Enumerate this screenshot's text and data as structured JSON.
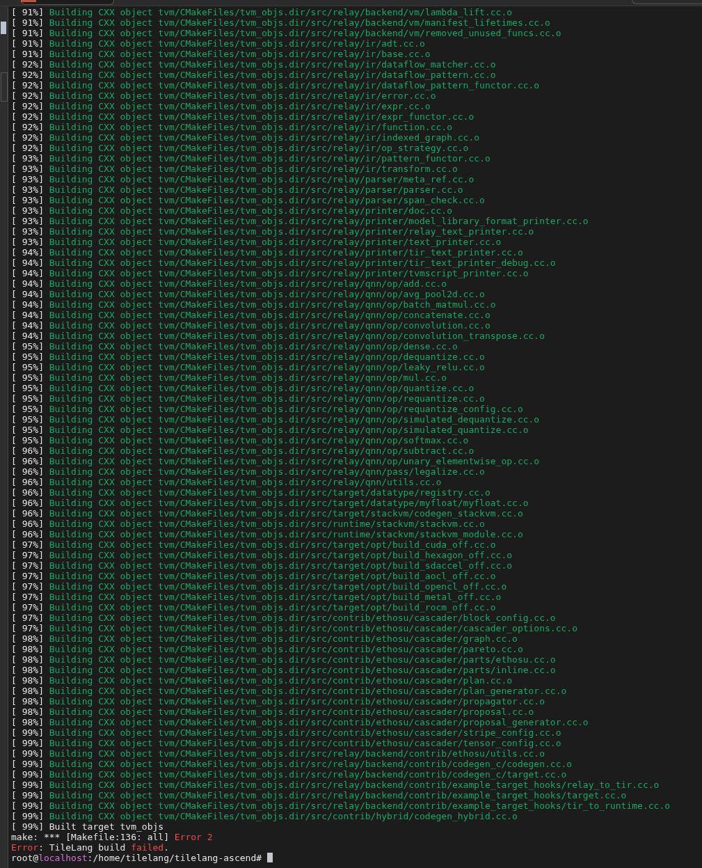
{
  "terminal": {
    "lines": [
      {
        "kind": "build",
        "progress": "[ 91%]",
        "text": "Building CXX object tvm/CMakeFiles/tvm_objs.dir/src/relay/backend/vm/lambda_lift.cc.o"
      },
      {
        "kind": "build",
        "progress": "[ 91%]",
        "text": "Building CXX object tvm/CMakeFiles/tvm_objs.dir/src/relay/backend/vm/manifest_lifetimes.cc.o"
      },
      {
        "kind": "build",
        "progress": "[ 91%]",
        "text": "Building CXX object tvm/CMakeFiles/tvm_objs.dir/src/relay/backend/vm/removed_unused_funcs.cc.o"
      },
      {
        "kind": "build",
        "progress": "[ 91%]",
        "text": "Building CXX object tvm/CMakeFiles/tvm_objs.dir/src/relay/ir/adt.cc.o"
      },
      {
        "kind": "build",
        "progress": "[ 91%]",
        "text": "Building CXX object tvm/CMakeFiles/tvm_objs.dir/src/relay/ir/base.cc.o"
      },
      {
        "kind": "build",
        "progress": "[ 92%]",
        "text": "Building CXX object tvm/CMakeFiles/tvm_objs.dir/src/relay/ir/dataflow_matcher.cc.o"
      },
      {
        "kind": "build",
        "progress": "[ 92%]",
        "text": "Building CXX object tvm/CMakeFiles/tvm_objs.dir/src/relay/ir/dataflow_pattern.cc.o"
      },
      {
        "kind": "build",
        "progress": "[ 92%]",
        "text": "Building CXX object tvm/CMakeFiles/tvm_objs.dir/src/relay/ir/dataflow_pattern_functor.cc.o"
      },
      {
        "kind": "build",
        "progress": "[ 92%]",
        "text": "Building CXX object tvm/CMakeFiles/tvm_objs.dir/src/relay/ir/error.cc.o"
      },
      {
        "kind": "build",
        "progress": "[ 92%]",
        "text": "Building CXX object tvm/CMakeFiles/tvm_objs.dir/src/relay/ir/expr.cc.o"
      },
      {
        "kind": "build",
        "progress": "[ 92%]",
        "text": "Building CXX object tvm/CMakeFiles/tvm_objs.dir/src/relay/ir/expr_functor.cc.o"
      },
      {
        "kind": "build",
        "progress": "[ 92%]",
        "text": "Building CXX object tvm/CMakeFiles/tvm_objs.dir/src/relay/ir/function.cc.o"
      },
      {
        "kind": "build",
        "progress": "[ 92%]",
        "text": "Building CXX object tvm/CMakeFiles/tvm_objs.dir/src/relay/ir/indexed_graph.cc.o"
      },
      {
        "kind": "build",
        "progress": "[ 92%]",
        "text": "Building CXX object tvm/CMakeFiles/tvm_objs.dir/src/relay/ir/op_strategy.cc.o"
      },
      {
        "kind": "build",
        "progress": "[ 93%]",
        "text": "Building CXX object tvm/CMakeFiles/tvm_objs.dir/src/relay/ir/pattern_functor.cc.o"
      },
      {
        "kind": "build",
        "progress": "[ 93%]",
        "text": "Building CXX object tvm/CMakeFiles/tvm_objs.dir/src/relay/ir/transform.cc.o"
      },
      {
        "kind": "build",
        "progress": "[ 93%]",
        "text": "Building CXX object tvm/CMakeFiles/tvm_objs.dir/src/relay/parser/meta_ref.cc.o"
      },
      {
        "kind": "build",
        "progress": "[ 93%]",
        "text": "Building CXX object tvm/CMakeFiles/tvm_objs.dir/src/relay/parser/parser.cc.o"
      },
      {
        "kind": "build",
        "progress": "[ 93%]",
        "text": "Building CXX object tvm/CMakeFiles/tvm_objs.dir/src/relay/parser/span_check.cc.o"
      },
      {
        "kind": "build",
        "progress": "[ 93%]",
        "text": "Building CXX object tvm/CMakeFiles/tvm_objs.dir/src/relay/printer/doc.cc.o"
      },
      {
        "kind": "build",
        "progress": "[ 93%]",
        "text": "Building CXX object tvm/CMakeFiles/tvm_objs.dir/src/relay/printer/model_library_format_printer.cc.o"
      },
      {
        "kind": "build",
        "progress": "[ 93%]",
        "text": "Building CXX object tvm/CMakeFiles/tvm_objs.dir/src/relay/printer/relay_text_printer.cc.o"
      },
      {
        "kind": "build",
        "progress": "[ 93%]",
        "text": "Building CXX object tvm/CMakeFiles/tvm_objs.dir/src/relay/printer/text_printer.cc.o"
      },
      {
        "kind": "build",
        "progress": "[ 94%]",
        "text": "Building CXX object tvm/CMakeFiles/tvm_objs.dir/src/relay/printer/tir_text_printer.cc.o"
      },
      {
        "kind": "build",
        "progress": "[ 94%]",
        "text": "Building CXX object tvm/CMakeFiles/tvm_objs.dir/src/relay/printer/tir_text_printer_debug.cc.o"
      },
      {
        "kind": "build",
        "progress": "[ 94%]",
        "text": "Building CXX object tvm/CMakeFiles/tvm_objs.dir/src/relay/printer/tvmscript_printer.cc.o"
      },
      {
        "kind": "build",
        "progress": "[ 94%]",
        "text": "Building CXX object tvm/CMakeFiles/tvm_objs.dir/src/relay/qnn/op/add.cc.o"
      },
      {
        "kind": "build",
        "progress": "[ 94%]",
        "text": "Building CXX object tvm/CMakeFiles/tvm_objs.dir/src/relay/qnn/op/avg_pool2d.cc.o"
      },
      {
        "kind": "build",
        "progress": "[ 94%]",
        "text": "Building CXX object tvm/CMakeFiles/tvm_objs.dir/src/relay/qnn/op/batch_matmul.cc.o"
      },
      {
        "kind": "build",
        "progress": "[ 94%]",
        "text": "Building CXX object tvm/CMakeFiles/tvm_objs.dir/src/relay/qnn/op/concatenate.cc.o"
      },
      {
        "kind": "build",
        "progress": "[ 94%]",
        "text": "Building CXX object tvm/CMakeFiles/tvm_objs.dir/src/relay/qnn/op/convolution.cc.o"
      },
      {
        "kind": "build",
        "progress": "[ 94%]",
        "text": "Building CXX object tvm/CMakeFiles/tvm_objs.dir/src/relay/qnn/op/convolution_transpose.cc.o"
      },
      {
        "kind": "build",
        "progress": "[ 95%]",
        "text": "Building CXX object tvm/CMakeFiles/tvm_objs.dir/src/relay/qnn/op/dense.cc.o"
      },
      {
        "kind": "build",
        "progress": "[ 95%]",
        "text": "Building CXX object tvm/CMakeFiles/tvm_objs.dir/src/relay/qnn/op/dequantize.cc.o"
      },
      {
        "kind": "build",
        "progress": "[ 95%]",
        "text": "Building CXX object tvm/CMakeFiles/tvm_objs.dir/src/relay/qnn/op/leaky_relu.cc.o"
      },
      {
        "kind": "build",
        "progress": "[ 95%]",
        "text": "Building CXX object tvm/CMakeFiles/tvm_objs.dir/src/relay/qnn/op/mul.cc.o"
      },
      {
        "kind": "build",
        "progress": "[ 95%]",
        "text": "Building CXX object tvm/CMakeFiles/tvm_objs.dir/src/relay/qnn/op/quantize.cc.o"
      },
      {
        "kind": "build",
        "progress": "[ 95%]",
        "text": "Building CXX object tvm/CMakeFiles/tvm_objs.dir/src/relay/qnn/op/requantize.cc.o"
      },
      {
        "kind": "build",
        "progress": "[ 95%]",
        "text": "Building CXX object tvm/CMakeFiles/tvm_objs.dir/src/relay/qnn/op/requantize_config.cc.o"
      },
      {
        "kind": "build",
        "progress": "[ 95%]",
        "text": "Building CXX object tvm/CMakeFiles/tvm_objs.dir/src/relay/qnn/op/simulated_dequantize.cc.o"
      },
      {
        "kind": "build",
        "progress": "[ 95%]",
        "text": "Building CXX object tvm/CMakeFiles/tvm_objs.dir/src/relay/qnn/op/simulated_quantize.cc.o"
      },
      {
        "kind": "build",
        "progress": "[ 95%]",
        "text": "Building CXX object tvm/CMakeFiles/tvm_objs.dir/src/relay/qnn/op/softmax.cc.o"
      },
      {
        "kind": "build",
        "progress": "[ 96%]",
        "text": "Building CXX object tvm/CMakeFiles/tvm_objs.dir/src/relay/qnn/op/subtract.cc.o"
      },
      {
        "kind": "build",
        "progress": "[ 96%]",
        "text": "Building CXX object tvm/CMakeFiles/tvm_objs.dir/src/relay/qnn/op/unary_elementwise_op.cc.o"
      },
      {
        "kind": "build",
        "progress": "[ 96%]",
        "text": "Building CXX object tvm/CMakeFiles/tvm_objs.dir/src/relay/qnn/pass/legalize.cc.o"
      },
      {
        "kind": "build",
        "progress": "[ 96%]",
        "text": "Building CXX object tvm/CMakeFiles/tvm_objs.dir/src/relay/qnn/utils.cc.o"
      },
      {
        "kind": "build",
        "progress": "[ 96%]",
        "text": "Building CXX object tvm/CMakeFiles/tvm_objs.dir/src/target/datatype/registry.cc.o"
      },
      {
        "kind": "build",
        "progress": "[ 96%]",
        "text": "Building CXX object tvm/CMakeFiles/tvm_objs.dir/src/target/datatype/myfloat/myfloat.cc.o"
      },
      {
        "kind": "build",
        "progress": "[ 96%]",
        "text": "Building CXX object tvm/CMakeFiles/tvm_objs.dir/src/target/stackvm/codegen_stackvm.cc.o"
      },
      {
        "kind": "build",
        "progress": "[ 96%]",
        "text": "Building CXX object tvm/CMakeFiles/tvm_objs.dir/src/runtime/stackvm/stackvm.cc.o"
      },
      {
        "kind": "build",
        "progress": "[ 96%]",
        "text": "Building CXX object tvm/CMakeFiles/tvm_objs.dir/src/runtime/stackvm/stackvm_module.cc.o"
      },
      {
        "kind": "build",
        "progress": "[ 97%]",
        "text": "Building CXX object tvm/CMakeFiles/tvm_objs.dir/src/target/opt/build_cuda_off.cc.o"
      },
      {
        "kind": "build",
        "progress": "[ 97%]",
        "text": "Building CXX object tvm/CMakeFiles/tvm_objs.dir/src/target/opt/build_hexagon_off.cc.o"
      },
      {
        "kind": "build",
        "progress": "[ 97%]",
        "text": "Building CXX object tvm/CMakeFiles/tvm_objs.dir/src/target/opt/build_sdaccel_off.cc.o"
      },
      {
        "kind": "build",
        "progress": "[ 97%]",
        "text": "Building CXX object tvm/CMakeFiles/tvm_objs.dir/src/target/opt/build_aocl_off.cc.o"
      },
      {
        "kind": "build",
        "progress": "[ 97%]",
        "text": "Building CXX object tvm/CMakeFiles/tvm_objs.dir/src/target/opt/build_opencl_off.cc.o"
      },
      {
        "kind": "build",
        "progress": "[ 97%]",
        "text": "Building CXX object tvm/CMakeFiles/tvm_objs.dir/src/target/opt/build_metal_off.cc.o"
      },
      {
        "kind": "build",
        "progress": "[ 97%]",
        "text": "Building CXX object tvm/CMakeFiles/tvm_objs.dir/src/target/opt/build_rocm_off.cc.o"
      },
      {
        "kind": "build",
        "progress": "[ 97%]",
        "text": "Building CXX object tvm/CMakeFiles/tvm_objs.dir/src/contrib/ethosu/cascader/block_config.cc.o"
      },
      {
        "kind": "build",
        "progress": "[ 97%]",
        "text": "Building CXX object tvm/CMakeFiles/tvm_objs.dir/src/contrib/ethosu/cascader/cascader_options.cc.o"
      },
      {
        "kind": "build",
        "progress": "[ 98%]",
        "text": "Building CXX object tvm/CMakeFiles/tvm_objs.dir/src/contrib/ethosu/cascader/graph.cc.o"
      },
      {
        "kind": "build",
        "progress": "[ 98%]",
        "text": "Building CXX object tvm/CMakeFiles/tvm_objs.dir/src/contrib/ethosu/cascader/pareto.cc.o"
      },
      {
        "kind": "build",
        "progress": "[ 98%]",
        "text": "Building CXX object tvm/CMakeFiles/tvm_objs.dir/src/contrib/ethosu/cascader/parts/ethosu.cc.o"
      },
      {
        "kind": "build",
        "progress": "[ 98%]",
        "text": "Building CXX object tvm/CMakeFiles/tvm_objs.dir/src/contrib/ethosu/cascader/parts/inline.cc.o"
      },
      {
        "kind": "build",
        "progress": "[ 98%]",
        "text": "Building CXX object tvm/CMakeFiles/tvm_objs.dir/src/contrib/ethosu/cascader/plan.cc.o"
      },
      {
        "kind": "build",
        "progress": "[ 98%]",
        "text": "Building CXX object tvm/CMakeFiles/tvm_objs.dir/src/contrib/ethosu/cascader/plan_generator.cc.o"
      },
      {
        "kind": "build",
        "progress": "[ 98%]",
        "text": "Building CXX object tvm/CMakeFiles/tvm_objs.dir/src/contrib/ethosu/cascader/propagator.cc.o"
      },
      {
        "kind": "build",
        "progress": "[ 98%]",
        "text": "Building CXX object tvm/CMakeFiles/tvm_objs.dir/src/contrib/ethosu/cascader/proposal.cc.o"
      },
      {
        "kind": "build",
        "progress": "[ 98%]",
        "text": "Building CXX object tvm/CMakeFiles/tvm_objs.dir/src/contrib/ethosu/cascader/proposal_generator.cc.o"
      },
      {
        "kind": "build",
        "progress": "[ 99%]",
        "text": "Building CXX object tvm/CMakeFiles/tvm_objs.dir/src/contrib/ethosu/cascader/stripe_config.cc.o"
      },
      {
        "kind": "build",
        "progress": "[ 99%]",
        "text": "Building CXX object tvm/CMakeFiles/tvm_objs.dir/src/contrib/ethosu/cascader/tensor_config.cc.o"
      },
      {
        "kind": "build",
        "progress": "[ 99%]",
        "text": "Building CXX object tvm/CMakeFiles/tvm_objs.dir/src/relay/backend/contrib/ethosu/utils.cc.o"
      },
      {
        "kind": "build",
        "progress": "[ 99%]",
        "text": "Building CXX object tvm/CMakeFiles/tvm_objs.dir/src/relay/backend/contrib/codegen_c/codegen.cc.o"
      },
      {
        "kind": "build",
        "progress": "[ 99%]",
        "text": "Building CXX object tvm/CMakeFiles/tvm_objs.dir/src/relay/backend/contrib/codegen_c/target.cc.o"
      },
      {
        "kind": "build",
        "progress": "[ 99%]",
        "text": "Building CXX object tvm/CMakeFiles/tvm_objs.dir/src/relay/backend/contrib/example_target_hooks/relay_to_tir.cc.o"
      },
      {
        "kind": "build",
        "progress": "[ 99%]",
        "text": "Building CXX object tvm/CMakeFiles/tvm_objs.dir/src/relay/backend/contrib/example_target_hooks/target.cc.o"
      },
      {
        "kind": "build",
        "progress": "[ 99%]",
        "text": "Building CXX object tvm/CMakeFiles/tvm_objs.dir/src/relay/backend/contrib/example_target_hooks/tir_to_runtime.cc.o"
      },
      {
        "kind": "build",
        "progress": "[ 99%]",
        "text": "Building CXX object tvm/CMakeFiles/tvm_objs.dir/src/contrib/hybrid/codegen_hybrid.cc.o"
      },
      {
        "kind": "plain",
        "segments": [
          {
            "text": "[ 99%] Built target tvm_objs"
          }
        ]
      },
      {
        "kind": "plain",
        "segments": [
          {
            "text": "make: *** [Makefile:136: all] "
          },
          {
            "text": "Error 2",
            "color": "#f14c4c"
          }
        ]
      },
      {
        "kind": "plain",
        "segments": [
          {
            "text": "Error",
            "color": "#f14c4c"
          },
          {
            "text": ": TileLang build "
          },
          {
            "text": "failed",
            "color": "#f14c4c"
          },
          {
            "text": "."
          }
        ]
      },
      {
        "kind": "prompt",
        "segments": [
          {
            "text": "root@"
          },
          {
            "text": "localhost",
            "color": "#d670d6"
          },
          {
            "text": ":/home/tilelang/tilelang-ascend#"
          }
        ]
      }
    ]
  }
}
